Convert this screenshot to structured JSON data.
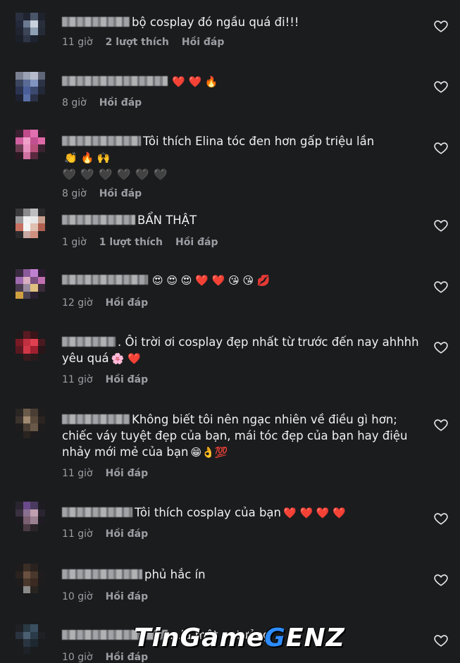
{
  "comments": [
    {
      "text": "bộ cosplay đó ngầu quá đi!!!",
      "time": "11 giờ",
      "likes": "2 lượt thích",
      "reply": "Hồi đáp",
      "emojis": ""
    },
    {
      "text": "",
      "time": "8 giờ",
      "likes": "",
      "reply": "Hồi đáp",
      "emojis": "❤️ ❤️ 🔥"
    },
    {
      "text": "Tôi thích Elina tóc đen hơn gấp triệu lần",
      "time": "8 giờ",
      "likes": "",
      "reply": "Hồi đáp",
      "emojis": "👏 🔥 🙌",
      "extra": "🖤🖤🖤🖤🖤🖤"
    },
    {
      "text": "BẨN THẬT",
      "time": "1 giờ",
      "likes": "1 lượt thích",
      "reply": "Hồi đáp",
      "emojis": ""
    },
    {
      "text": "",
      "time": "12 giờ",
      "likes": "",
      "reply": "Hồi đáp",
      "emojis": "😍 😍 😍 ❤️ ❤️ 😘 😘 💋"
    },
    {
      "text": ". Ôi trời ơi cosplay đẹp nhất từ trước đến nay ahhhh yêu quá",
      "time": "11 giờ",
      "likes": "",
      "reply": "Hồi đáp",
      "emojis": "🌸 ❤️"
    },
    {
      "text": "Không biết tôi nên ngạc nhiên về điều gì hơn; chiếc váy tuyệt đẹp của bạn, mái tóc đẹp của bạn hay điệu nhảy mới mẻ của bạn",
      "time": "11 giờ",
      "likes": "",
      "reply": "Hồi đáp",
      "emojis": "😁👌💯"
    },
    {
      "text": "Tôi thích cosplay của bạn",
      "time": "11 giờ",
      "likes": "",
      "reply": "Hồi đáp",
      "emojis": "❤️ ❤️ ❤️ ❤️"
    },
    {
      "text": "phủ hắc ín",
      "time": "10 giờ",
      "likes": "",
      "reply": "Hồi đáp",
      "emojis": ""
    },
    {
      "text": "...là một ... tưởng",
      "time": "10 giờ",
      "likes": "",
      "reply": "Hồi đáp",
      "emojis": ""
    }
  ],
  "watermark": {
    "part1": "TinGame",
    "part2": "G",
    "part3": "ENZ"
  },
  "icons": {
    "like": "heart-outline-icon"
  },
  "colors": {
    "background": "#1b1c1e",
    "text": "#f1f1f1",
    "meta": "#9c9ea3",
    "red_heart": "#e0245e"
  }
}
